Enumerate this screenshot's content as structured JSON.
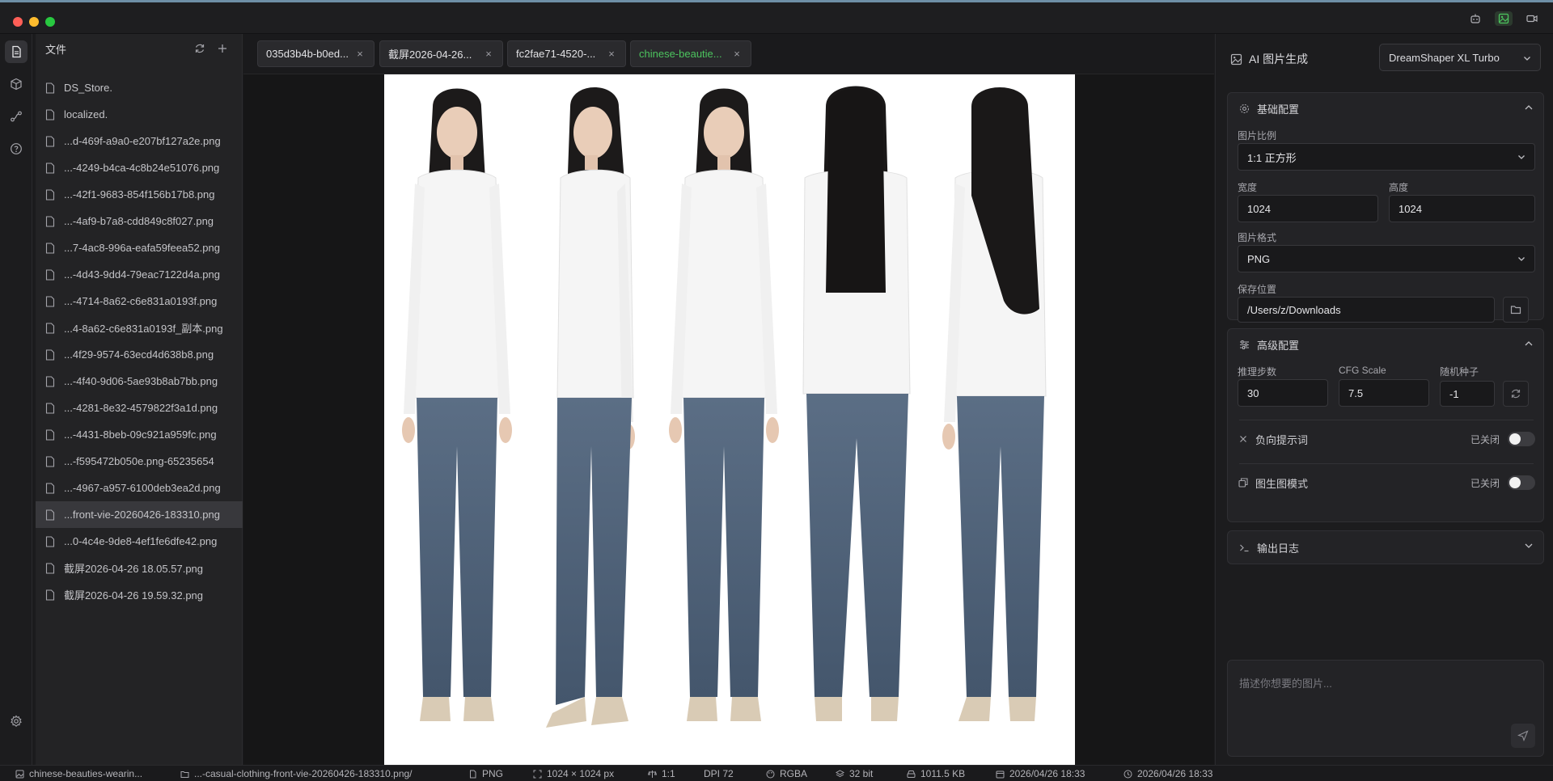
{
  "sidebar": {
    "title": "文件",
    "files": [
      "DS_Store.",
      "localized.",
      "...d-469f-a9a0-e207bf127a2e.png",
      "...-4249-b4ca-4c8b24e51076.png",
      "...-42f1-9683-854f156b17b8.png",
      "...-4af9-b7a8-cdd849c8f027.png",
      "...7-4ac8-996a-eafa59feea52.png",
      "...-4d43-9dd4-79eac7122d4a.png",
      "...-4714-8a62-c6e831a0193f.png",
      "...4-8a62-c6e831a0193f_副本.png",
      "...4f29-9574-63ecd4d638b8.png",
      "...-4f40-9d06-5ae93b8ab7bb.png",
      "...-4281-8e32-4579822f3a1d.png",
      "...-4431-8beb-09c921a959fc.png",
      "...-f595472b050e.png-65235654",
      "...-4967-a957-6100deb3ea2d.png",
      "...front-vie-20260426-183310.png",
      "...0-4c4e-9de8-4ef1fe6dfe42.png",
      "截屏2026-04-26 18.05.57.png",
      "截屏2026-04-26 19.59.32.png"
    ]
  },
  "tabs": [
    "035d3b4b-b0ed...",
    "截屏2026-04-26...",
    "fc2fae71-4520-...",
    "chinese-beautie..."
  ],
  "panel": {
    "title": "AI 图片生成",
    "model": "DreamShaper XL Turbo",
    "basic": {
      "title": "基础配置",
      "ratio_label": "图片比例",
      "ratio_value": "1:1 正方形",
      "width_label": "宽度",
      "width_value": "1024",
      "height_label": "高度",
      "height_value": "1024",
      "format_label": "图片格式",
      "format_value": "PNG",
      "save_label": "保存位置",
      "save_value": "/Users/z/Downloads"
    },
    "advanced": {
      "title": "高级配置",
      "steps_label": "推理步数",
      "steps_value": "30",
      "cfg_label": "CFG Scale",
      "cfg_value": "7.5",
      "seed_label": "随机种子",
      "seed_value": "-1",
      "negative_label": "负向提示词",
      "negative_state": "已关闭",
      "img2img_label": "图生图模式",
      "img2img_state": "已关闭"
    },
    "log": {
      "title": "输出日志"
    },
    "prompt_placeholder": "描述你想要的图片..."
  },
  "status": {
    "file": "chinese-beauties-wearin...",
    "path": "...-casual-clothing-front-vie-20260426-183310.png/",
    "format": "PNG",
    "dimensions": "1024 × 1024 px",
    "ratio": "1:1",
    "dpi": "DPI 72",
    "color": "RGBA",
    "depth": "32 bit",
    "size": "1011.5 KB",
    "created": "2026/04/26 18:33",
    "modified": "2026/04/26 18:33"
  },
  "colors": {
    "accent_green": "#4cc45e",
    "close": "#ff5f57",
    "minimize": "#febc2e",
    "zoom": "#28c840"
  }
}
